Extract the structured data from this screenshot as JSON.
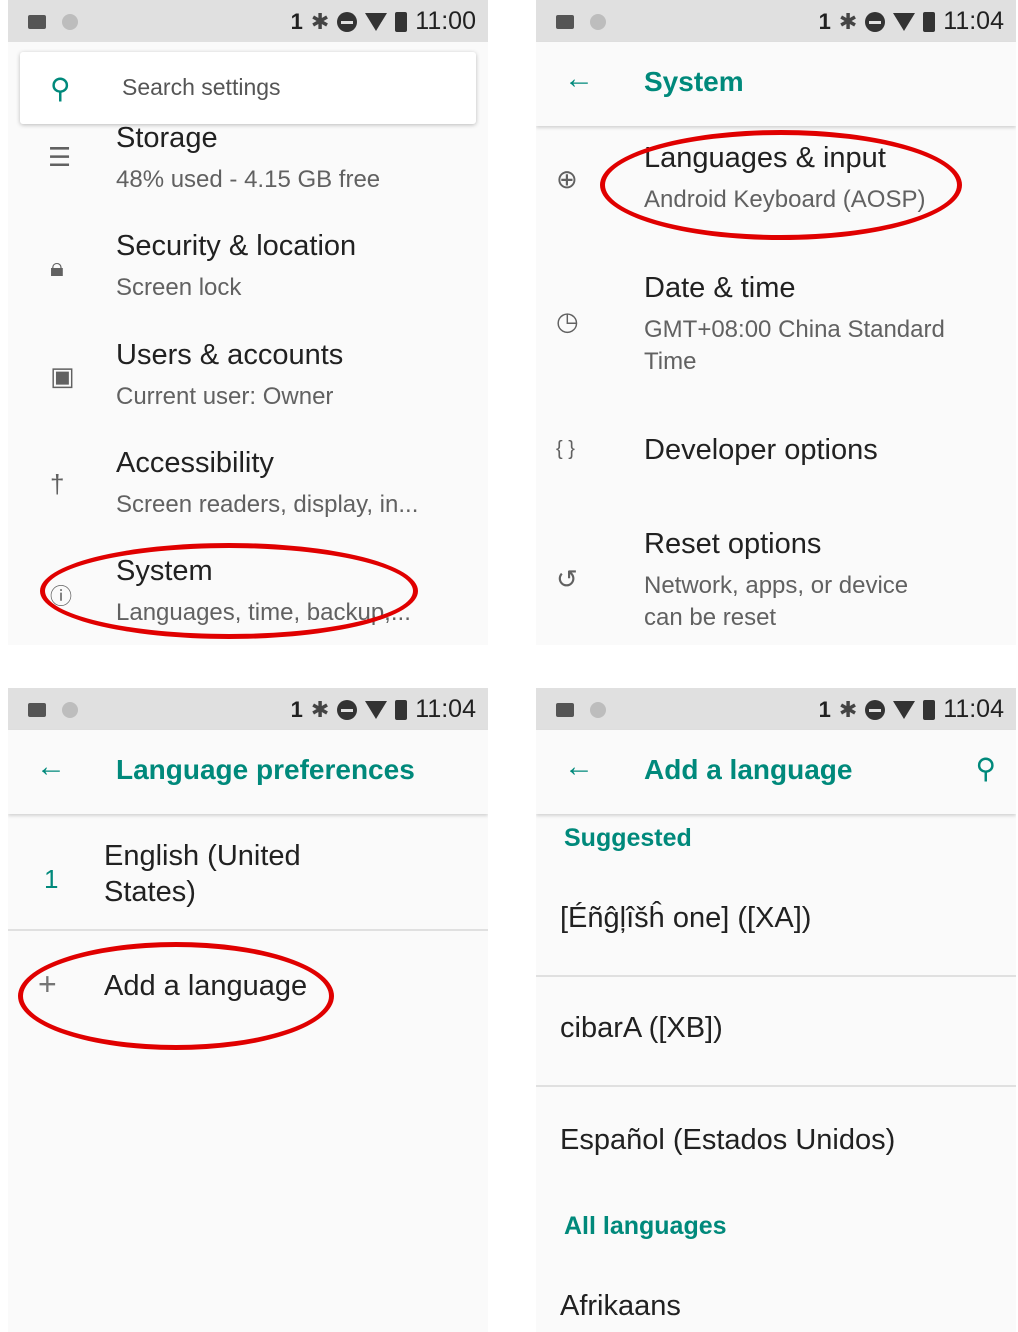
{
  "status_bar": {
    "sim": "1",
    "time_p1": "11:00",
    "time_p2": "11:04",
    "time_p3": "11:04",
    "time_p4": "11:04",
    "icons": [
      "image-icon",
      "notification-dot-icon",
      "bluetooth-icon",
      "do-not-disturb-icon",
      "wifi-icon",
      "battery-icon"
    ]
  },
  "panel1": {
    "search_placeholder": "Search settings",
    "items": [
      {
        "title": "Storage",
        "subtitle": "48% used - 4.15 GB free",
        "icon": "storage-icon"
      },
      {
        "title": "Security & location",
        "subtitle": "Screen lock",
        "icon": "lock-icon"
      },
      {
        "title": "Users & accounts",
        "subtitle": "Current user: Owner",
        "icon": "account-icon"
      },
      {
        "title": "Accessibility",
        "subtitle": "Screen readers, display, in...",
        "icon": "accessibility-icon"
      },
      {
        "title": "System",
        "subtitle": "Languages, time, backup,...",
        "icon": "info-icon"
      }
    ]
  },
  "panel2": {
    "title": "System",
    "items": [
      {
        "title": "Languages & input",
        "subtitle": "Android Keyboard (AOSP)",
        "icon": "globe-icon"
      },
      {
        "title": "Date & time",
        "subtitle_line1": "GMT+08:00 China Standard",
        "subtitle_line2": "Time",
        "icon": "clock-icon"
      },
      {
        "title": "Developer options",
        "icon": "braces-icon"
      },
      {
        "title": "Reset options",
        "subtitle_line1": "Network, apps, or device",
        "subtitle_line2": "can be reset",
        "icon": "restore-icon"
      }
    ]
  },
  "panel3": {
    "title": "Language preferences",
    "languages": [
      {
        "index": "1",
        "line1": "English (United",
        "line2": "States)"
      }
    ],
    "add_label": "Add a language"
  },
  "panel4": {
    "title": "Add a language",
    "suggested_label": "Suggested",
    "suggested": [
      "[Éñĝļîšĥ one] ([XA])",
      "cibarA ([XB])",
      "Español (Estados Unidos)"
    ],
    "all_label": "All languages",
    "all": [
      "Afrikaans"
    ]
  },
  "colors": {
    "accent": "#00897b",
    "highlight": "#e00000",
    "status_bar": "#e0e0e0"
  }
}
